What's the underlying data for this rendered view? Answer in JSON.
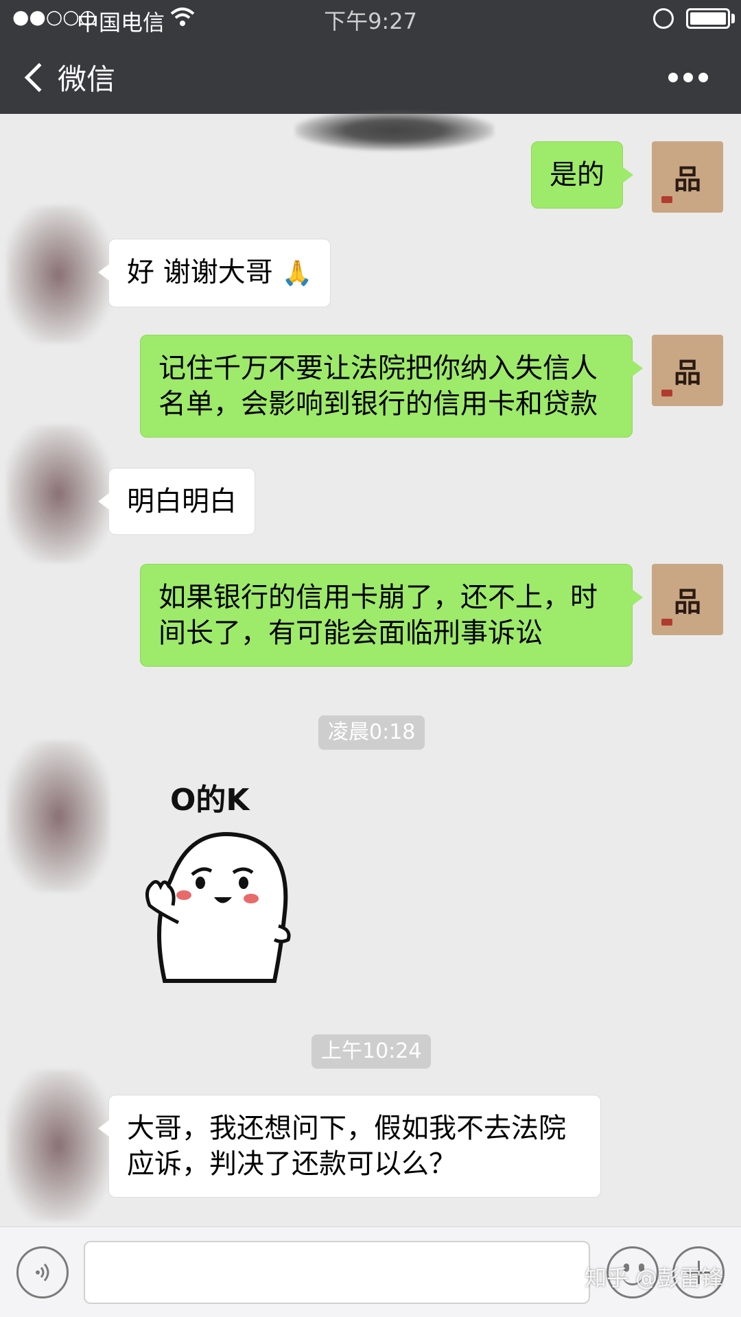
{
  "status_bar": {
    "signal": "●●○○○",
    "carrier": "中国电信",
    "time": "下午9:27"
  },
  "nav": {
    "back_label": "微信"
  },
  "messages": [
    {
      "direction": "out",
      "text": "是的"
    },
    {
      "direction": "in",
      "text": "好 谢谢大哥"
    },
    {
      "direction": "out",
      "text": "记住千万不要让法院把你纳入失信人名单，会影响到银行的信用卡和贷款"
    },
    {
      "direction": "in",
      "text": "明白明白"
    },
    {
      "direction": "out",
      "text": "如果银行的信用卡崩了，还不上，时间长了，有可能会面临刑事诉讼"
    },
    {
      "direction": "in",
      "text": "大哥，我还想问下，假如我不去法院应诉，判决了还款可以么？"
    }
  ],
  "timestamps": [
    "凌晨0:18",
    "上午10:24"
  ],
  "sticker": {
    "caption": "O的K"
  },
  "avatar_right": {
    "glyph": "品"
  },
  "watermark": "知乎 @彭雷锋",
  "colors": {
    "header_bg": "#393a3e",
    "chat_bg": "#ebebeb",
    "outgoing_bubble": "#9eea6a",
    "incoming_bubble": "#ffffff",
    "timestamp_bg": "#cecece"
  },
  "icons": [
    "back-chevron-icon",
    "more-icon",
    "voice-icon",
    "emoji-icon",
    "plus-icon",
    "wifi-icon",
    "lock-rotation-icon",
    "battery-icon"
  ]
}
